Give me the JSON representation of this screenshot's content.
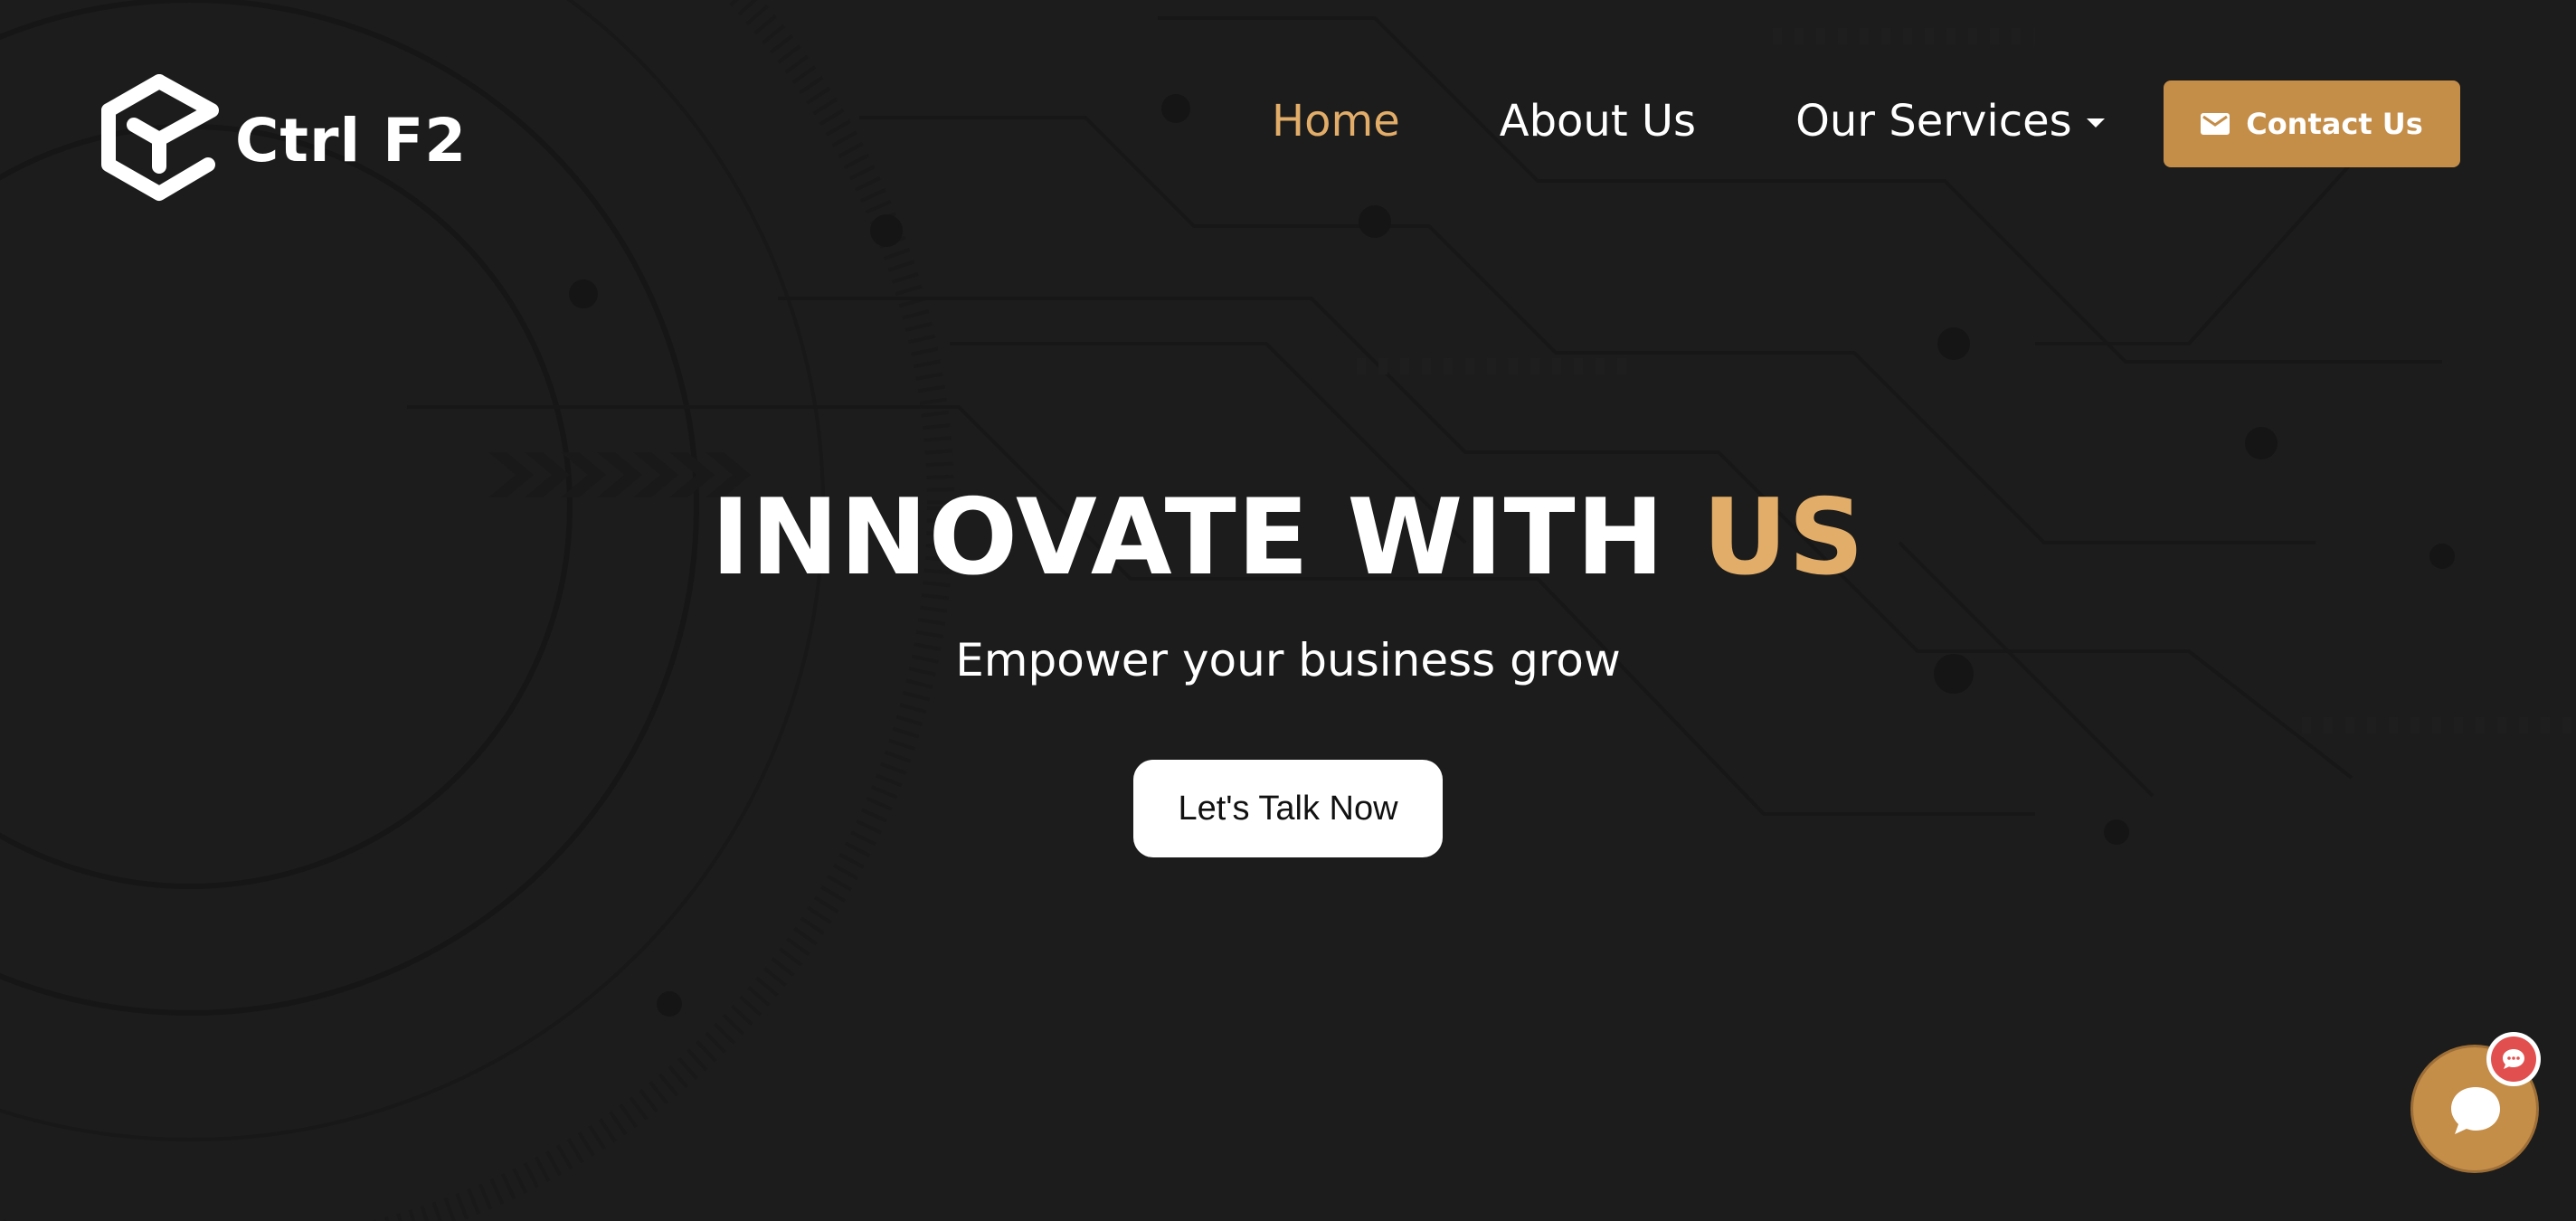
{
  "brand": {
    "name": "Ctrl F2"
  },
  "nav": {
    "items": [
      {
        "label": "Home",
        "active": true
      },
      {
        "label": "About Us",
        "active": false
      },
      {
        "label": "Our Services",
        "active": false,
        "has_dropdown": true
      }
    ]
  },
  "header": {
    "contact_label": "Contact Us",
    "contact_icon": "mail-icon"
  },
  "hero": {
    "title_main": "INNOVATE WITH",
    "title_accent": "US",
    "subtitle": "Empower your business grow",
    "cta_label": "Let's Talk Now"
  },
  "chat": {
    "icon": "chat-bubble-icon",
    "badge_icon": "chat-dots-icon"
  },
  "colors": {
    "background": "#1c1c1c",
    "accent": "#e2ad68",
    "button_gold": "#c48d48",
    "badge_red": "#e24f4f",
    "text": "#ffffff"
  }
}
